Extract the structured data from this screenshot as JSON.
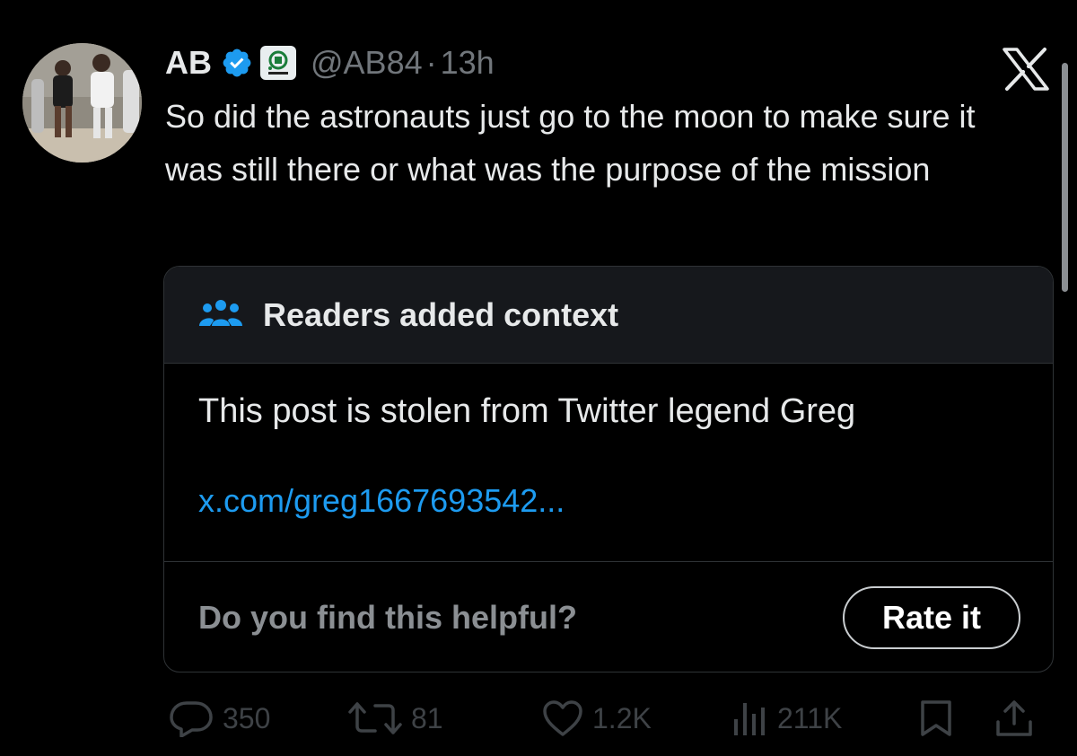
{
  "author": {
    "name": "AB",
    "handle": "@AB84",
    "separator": "·",
    "time": "13h"
  },
  "tweet": {
    "text": "So did the astronauts just go to the moon to make sure it was still there or what was the purpose of the mission"
  },
  "community_note": {
    "header": "Readers added context",
    "body": "This post is stolen from Twitter legend Greg",
    "link": "x.com/greg1667693542...",
    "prompt": "Do you find this helpful?",
    "rate_label": "Rate it"
  },
  "actions": {
    "replies": "350",
    "reposts": "81",
    "likes": "1.2K",
    "views": "211K"
  },
  "icons": [
    "verified-badge-icon",
    "affiliate-badge-icon",
    "x-logo-icon",
    "people-icon",
    "reply-icon",
    "repost-icon",
    "like-icon",
    "views-icon",
    "bookmark-icon",
    "share-icon"
  ],
  "colors": {
    "background": "#000000",
    "text": "#e7e9ea",
    "muted": "#71767b",
    "link": "#1d9bf0",
    "verified": "#1d9bf0",
    "note_header_bg": "#16181c",
    "border": "#2f3336"
  }
}
